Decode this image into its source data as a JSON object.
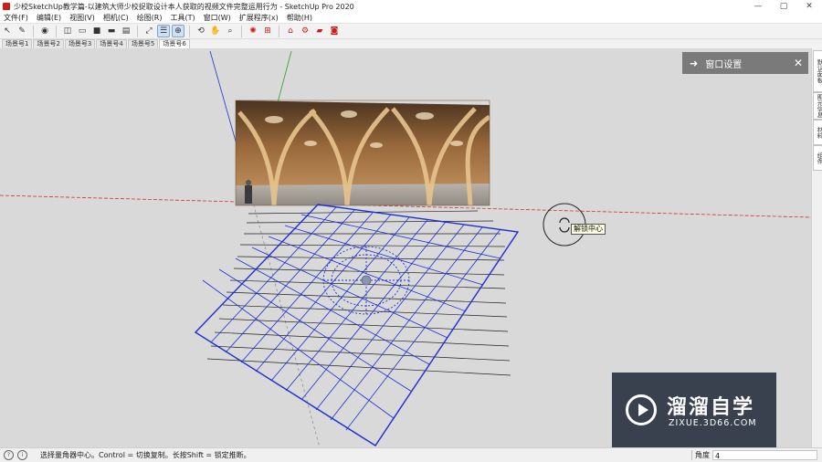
{
  "window": {
    "title": "少校SketchUp教学篇-以建筑大师少校捉取设计本人获取的视频文件完整运用行为 - SketchUp Pro 2020",
    "controls": [
      "—",
      "▢",
      "✕"
    ]
  },
  "menu": [
    "文件(F)",
    "编辑(E)",
    "视图(V)",
    "相机(C)",
    "绘图(R)",
    "工具(T)",
    "窗口(W)",
    "扩展程序(x)",
    "帮助(H)"
  ],
  "scenes": [
    "场景号1",
    "场景号2",
    "场景号3",
    "场景号4",
    "场景号5",
    "场景号6"
  ],
  "tray": {
    "title": "窗口设置"
  },
  "right_tabs": [
    "默认面板",
    "图元信息",
    "材料",
    "组件"
  ],
  "tooltip": "解锁中心",
  "status": {
    "hint": "选择量角器中心。Control = 切换复制。长按Shift = 锁定推断。",
    "measurement_label": "角度",
    "measurement_value": "4"
  },
  "watermark": {
    "title": "溜溜自学",
    "url": "ZIXUE.3D66.COM"
  },
  "colors": {
    "viewport_bg": "#d9d9d9",
    "grid": "#1a2fd6",
    "red_axis": "#cc3333",
    "green_axis": "#33aa33",
    "blue_axis": "#3344cc"
  }
}
